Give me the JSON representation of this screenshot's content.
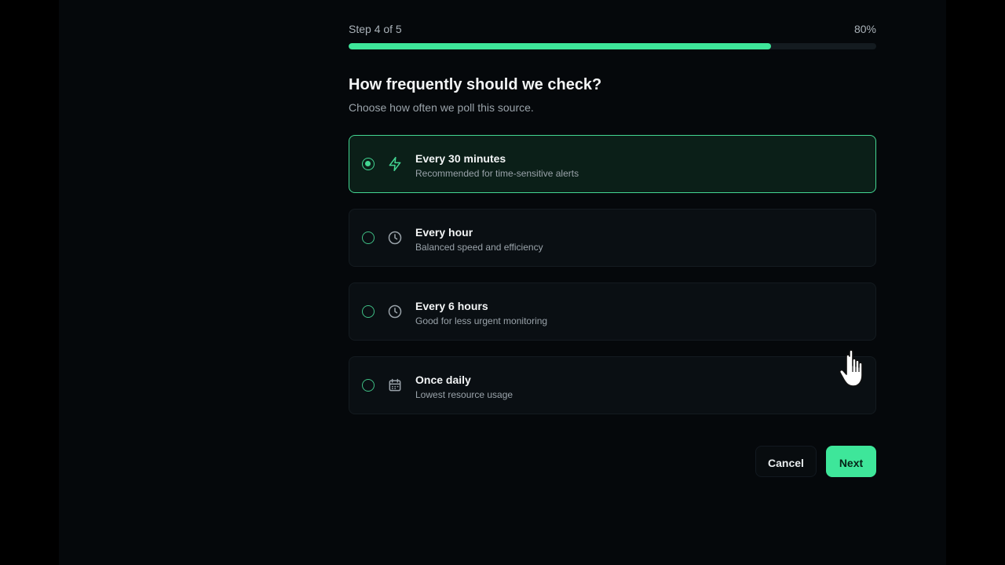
{
  "progress": {
    "step_text": "Step 4 of 5",
    "percent_text": "80%",
    "value": 0.8,
    "color": "#3ee69a"
  },
  "question": {
    "title": "How frequently should we check?",
    "subtitle": "Choose how often we poll this source."
  },
  "options": [
    {
      "label": "Every 30 minutes",
      "description": "Recommended for time-sensitive alerts",
      "icon": "lightning-icon",
      "selected": true
    },
    {
      "label": "Every hour",
      "description": "Balanced speed and efficiency",
      "icon": "clock-icon",
      "selected": false
    },
    {
      "label": "Every 6 hours",
      "description": "Good for less urgent monitoring",
      "icon": "clock-icon",
      "selected": false
    },
    {
      "label": "Once daily",
      "description": "Lowest resource usage",
      "icon": "calendar-icon",
      "selected": false
    }
  ],
  "actions": {
    "cancel_label": "Cancel",
    "next_label": "Next"
  },
  "colors": {
    "accent": "#3ee69a",
    "background": "#05080b"
  }
}
